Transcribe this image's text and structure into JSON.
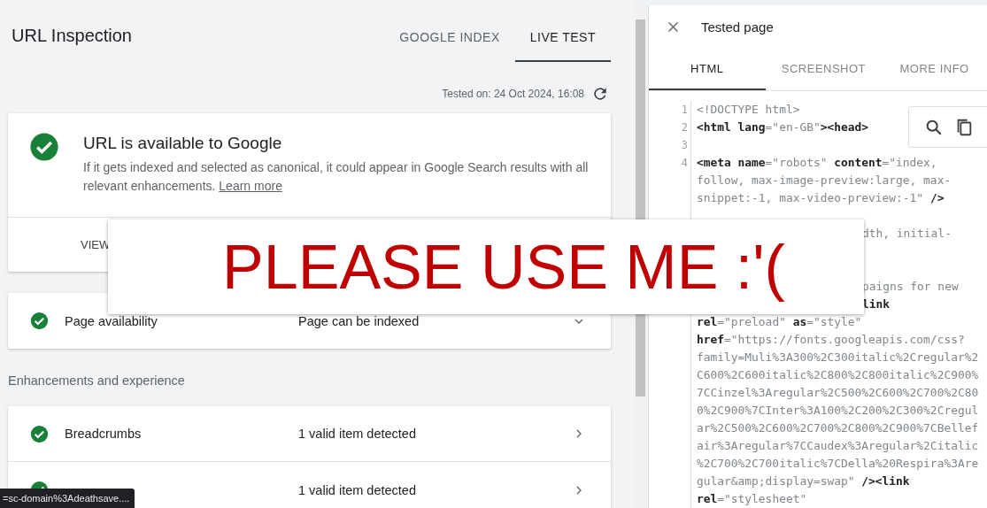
{
  "header": {
    "title": "URL Inspection",
    "tabs": [
      {
        "label": "GOOGLE INDEX",
        "selected": false
      },
      {
        "label": "LIVE TEST",
        "selected": true
      }
    ]
  },
  "tested_on": "Tested on: 24 Oct 2024, 16:08",
  "status_card": {
    "title": "URL is available to Google",
    "description": "If it gets indexed and selected as canonical, it could appear in Google Search results with all relevant enhancements.",
    "link": "Learn more",
    "button": "VIEW"
  },
  "availability": [
    {
      "label": "Page availability",
      "value": "Page can be indexed",
      "ok": true,
      "expanded": false
    }
  ],
  "section_heading": "Enhancements and experience",
  "enhancements": [
    {
      "label": "Breadcrumbs",
      "value": "1 valid item detected",
      "ok": true
    },
    {
      "value": "1 valid item detected",
      "ok": true
    }
  ],
  "overlay": {
    "text": "PLEASE USE ME :'("
  },
  "tooltip": "=sc-domain%3Adeathsave....",
  "panel": {
    "title": "Tested page",
    "tabs": [
      {
        "label": "HTML",
        "selected": true
      },
      {
        "label": "SCREENSHOT",
        "selected": false
      },
      {
        "label": "MORE INFO",
        "selected": false
      }
    ],
    "code": [
      {
        "number": "1",
        "segments": [
          {
            "text": "<!DOCTYPE html>",
            "kind": "light"
          }
        ]
      },
      {
        "number": "2",
        "segments": [
          {
            "text": "<html lang",
            "kind": "bold"
          },
          {
            "text": "=\"en-GB\"",
            "kind": "light"
          },
          {
            "text": "><head>",
            "kind": "bold"
          }
        ]
      },
      {
        "number": "3"
      },
      {
        "number": "4",
        "segments": [
          {
            "text": "<meta name",
            "kind": "bold"
          },
          {
            "text": "=\"robots\" ",
            "kind": "light"
          },
          {
            "text": "content",
            "kind": "bold"
          },
          {
            "text": "=\"index,",
            "kind": "light"
          }
        ]
      },
      {
        "segments": [
          {
            "text": "follow, max-image-preview:large, max-",
            "kind": "light"
          }
        ]
      },
      {
        "segments": [
          {
            "text": "snippet:-1, max-video-preview:-1\" ",
            "kind": "light"
          },
          {
            "text": "/>",
            "kind": "bold"
          }
        ]
      },
      {
        "kind": "covered"
      },
      {
        "kind": "partial",
        "segments": [
          {
            "text": "dth, initial-",
            "kind": "light"
          }
        ]
      },
      {
        "kind": "covered"
      },
      {
        "kind": "covered"
      },
      {
        "kind": "partial",
        "segments": [
          {
            "text": "paigns for new",
            "kind": "light"
          }
        ]
      },
      {
        "kind": "partial",
        "segments": [
          {
            "text": "link",
            "kind": "bold"
          }
        ]
      },
      {
        "segments": [
          {
            "text": "rel",
            "kind": "bold"
          },
          {
            "text": "=\"preload\" ",
            "kind": "light"
          },
          {
            "text": "as",
            "kind": "bold"
          },
          {
            "text": "=\"style\"",
            "kind": "light"
          }
        ]
      },
      {
        "segments": [
          {
            "text": "href",
            "kind": "bold"
          },
          {
            "text": "=\"https://fonts.googleapis.com/css?",
            "kind": "light"
          }
        ]
      },
      {
        "segments": [
          {
            "text": "family=Muli%3A300%2C300italic%2Cregular%2",
            "kind": "light"
          }
        ]
      },
      {
        "segments": [
          {
            "text": "C600%2C600italic%2C800%2C800italic%2C900%",
            "kind": "light"
          }
        ]
      },
      {
        "segments": [
          {
            "text": "7CCinzel%3Aregular%2C500%2C600%2C700%2C80",
            "kind": "light"
          }
        ]
      },
      {
        "segments": [
          {
            "text": "0%2C900%7CInter%3A100%2C200%2C300%2Cregul",
            "kind": "light"
          }
        ]
      },
      {
        "segments": [
          {
            "text": "ar%2C500%2C600%2C700%2C800%2C900%7CBellef",
            "kind": "light"
          }
        ]
      },
      {
        "segments": [
          {
            "text": "air%3Aregular%7CCaudex%3Aregular%2Citalic",
            "kind": "light"
          }
        ]
      },
      {
        "segments": [
          {
            "text": "%2C700%2C700italic%7CDella%20Respira%3Are",
            "kind": "light"
          }
        ]
      },
      {
        "segments": [
          {
            "text": "gular&amp;display=swap\" ",
            "kind": "light"
          },
          {
            "text": "/><link",
            "kind": "bold"
          }
        ]
      },
      {
        "segments": [
          {
            "text": "rel",
            "kind": "bold"
          },
          {
            "text": "=\"stylesheet\"",
            "kind": "light"
          }
        ]
      }
    ]
  }
}
